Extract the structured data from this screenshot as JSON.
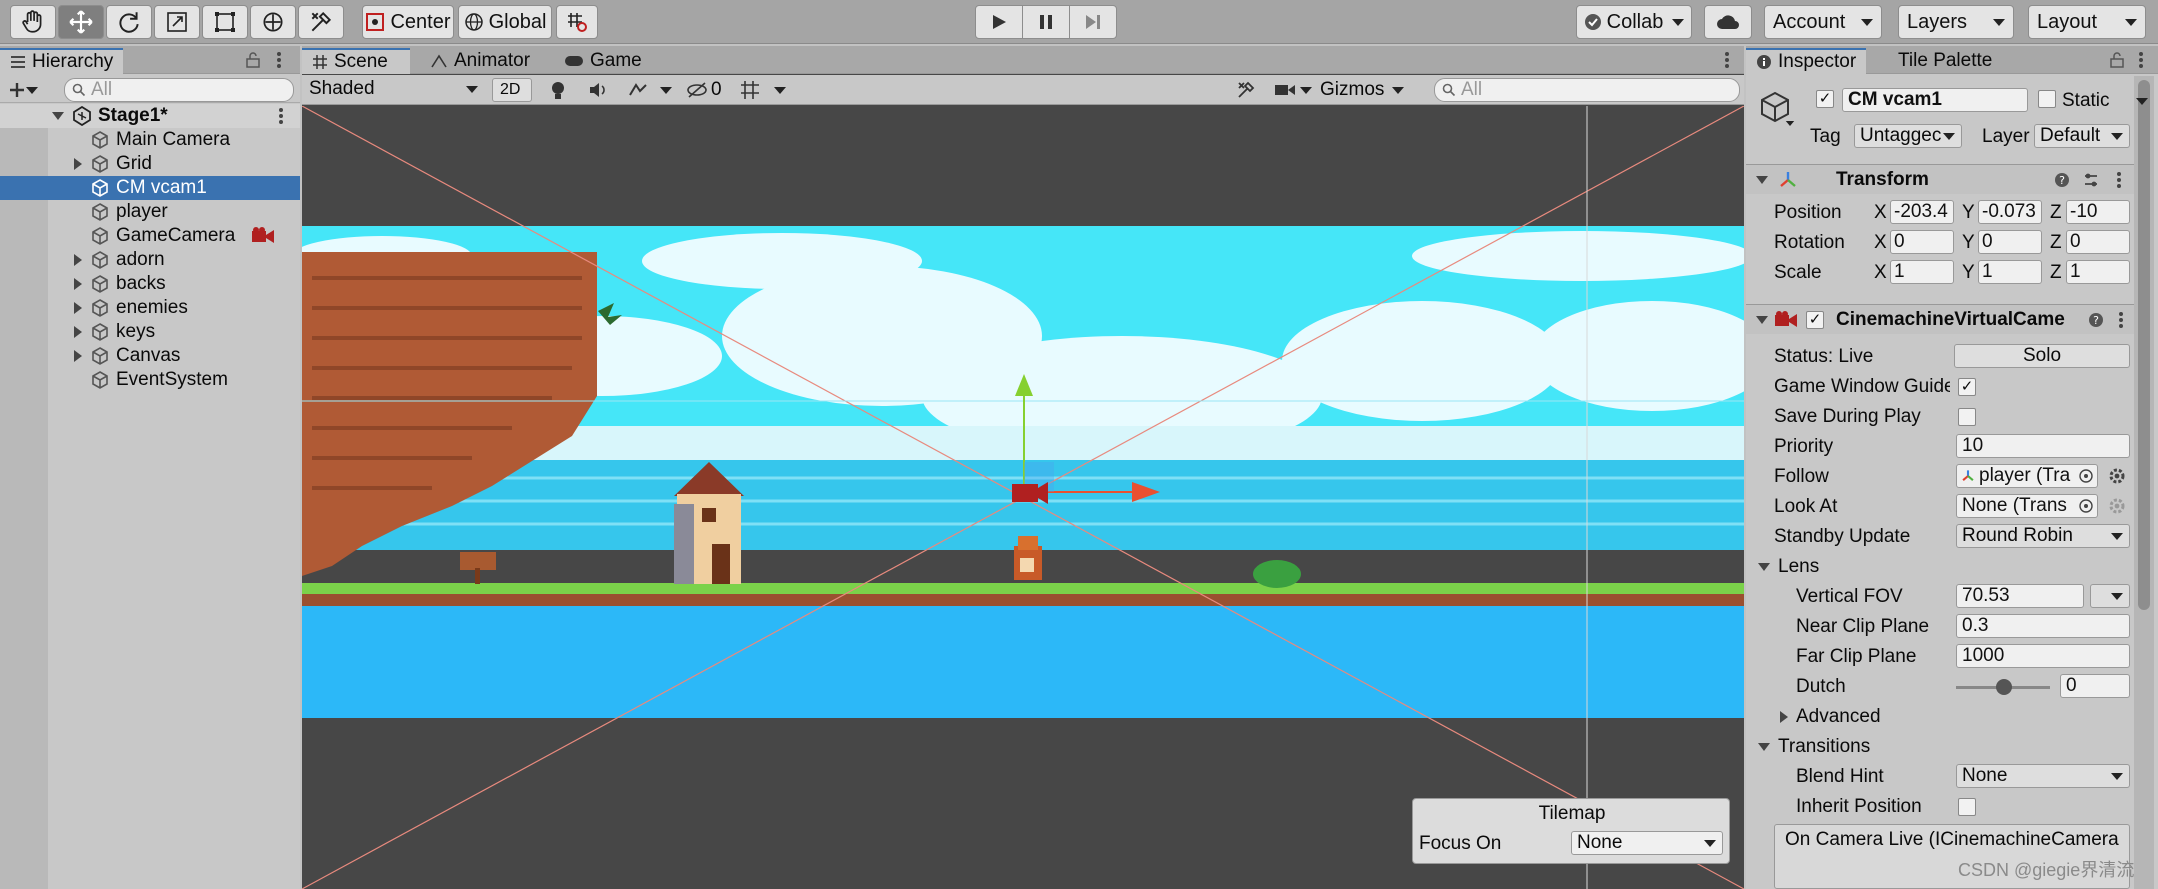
{
  "toolbar": {
    "tools": [
      "hand-tool-icon",
      "move-tool-icon",
      "rotate-tool-icon",
      "scale-tool-icon",
      "rect-tool-icon",
      "transform-tool-icon",
      "custom-tool-icon"
    ],
    "pivot_label": "Center",
    "space_label": "Global",
    "collab_label": "Collab",
    "account_label": "Account",
    "layers_label": "Layers",
    "layout_label": "Layout"
  },
  "hierarchy": {
    "tab_label": "Hierarchy",
    "search_placeholder": "All",
    "scene_name": "Stage1*",
    "items": [
      {
        "label": "Main Camera",
        "expandable": false
      },
      {
        "label": "Grid",
        "expandable": true
      },
      {
        "label": "CM vcam1",
        "expandable": false,
        "selected": true
      },
      {
        "label": "player",
        "expandable": false
      },
      {
        "label": "GameCamera",
        "expandable": false
      },
      {
        "label": "adorn",
        "expandable": true
      },
      {
        "label": "backs",
        "expandable": true
      },
      {
        "label": "enemies",
        "expandable": true
      },
      {
        "label": "keys",
        "expandable": true
      },
      {
        "label": "Canvas",
        "expandable": true
      },
      {
        "label": "EventSystem",
        "expandable": false
      }
    ]
  },
  "scene": {
    "tabs": [
      "Scene",
      "Animator",
      "Game"
    ],
    "shading_mode": "Shaded",
    "mode_2d": "2D",
    "hidden_count": "0",
    "gizmos_label": "Gizmos",
    "search_placeholder": "All",
    "overlay_title": "Tilemap",
    "overlay_focus_label": "Focus On",
    "overlay_focus_value": "None"
  },
  "inspector": {
    "tabs": [
      "Inspector",
      "Tile Palette"
    ],
    "object_name": "CM vcam1",
    "static_label": "Static",
    "tag_label": "Tag",
    "tag_value": "Untaggec",
    "layer_label": "Layer",
    "layer_value": "Default",
    "transform": {
      "title": "Transform",
      "position_label": "Position",
      "rotation_label": "Rotation",
      "scale_label": "Scale",
      "position": [
        "-203.4",
        "-0.073",
        "-10"
      ],
      "rotation": [
        "0",
        "0",
        "0"
      ],
      "scale": [
        "1",
        "1",
        "1"
      ]
    },
    "vcam": {
      "title": "CinemachineVirtualCame",
      "status_label": "Status: Live",
      "solo_label": "Solo",
      "game_window_label": "Game Window Guide",
      "save_label": "Save During Play",
      "priority_label": "Priority",
      "priority_value": "10",
      "follow_label": "Follow",
      "follow_value": "player (Tra",
      "lookat_label": "Look At",
      "lookat_value": "None (Trans",
      "standby_label": "Standby Update",
      "standby_value": "Round Robin",
      "lens_label": "Lens",
      "fov_label": "Vertical FOV",
      "fov_value": "70.53",
      "near_label": "Near Clip Plane",
      "near_value": "0.3",
      "far_label": "Far Clip Plane",
      "far_value": "1000",
      "dutch_label": "Dutch",
      "dutch_value": "0",
      "advanced_label": "Advanced",
      "transitions_label": "Transitions",
      "blend_label": "Blend Hint",
      "blend_value": "None",
      "inherit_label": "Inherit Position",
      "event_label": "On Camera Live (ICinemachineCamera"
    }
  },
  "watermark": "CSDN @giegie界清流"
}
